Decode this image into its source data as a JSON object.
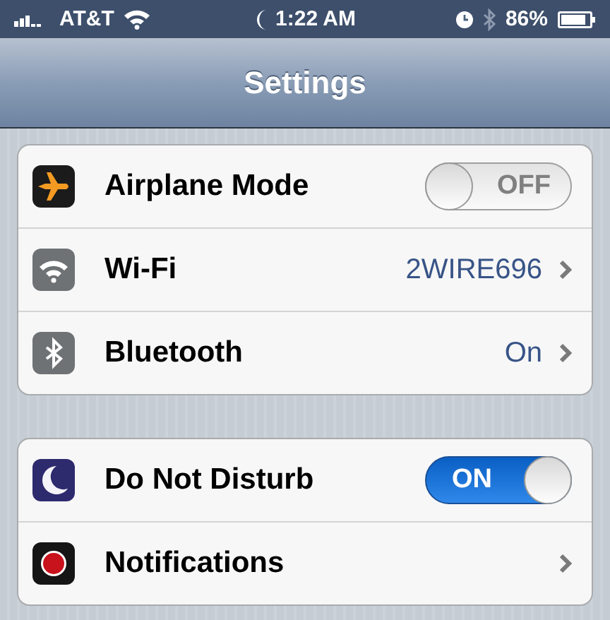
{
  "status_bar": {
    "carrier": "AT&T",
    "time": "1:22 AM",
    "battery": "86%"
  },
  "nav_bar": {
    "title": "Settings"
  },
  "groups": [
    {
      "rows": [
        {
          "kind": "toggle",
          "label": "Airplane Mode",
          "on": false,
          "switch_text": "OFF"
        },
        {
          "kind": "link",
          "label": "Wi-Fi",
          "value": "2WIRE696"
        },
        {
          "kind": "link",
          "label": "Bluetooth",
          "value": "On"
        }
      ]
    },
    {
      "rows": [
        {
          "kind": "toggle",
          "label": "Do Not Disturb",
          "on": true,
          "switch_text": "ON"
        },
        {
          "kind": "link",
          "label": "Notifications"
        }
      ]
    }
  ]
}
